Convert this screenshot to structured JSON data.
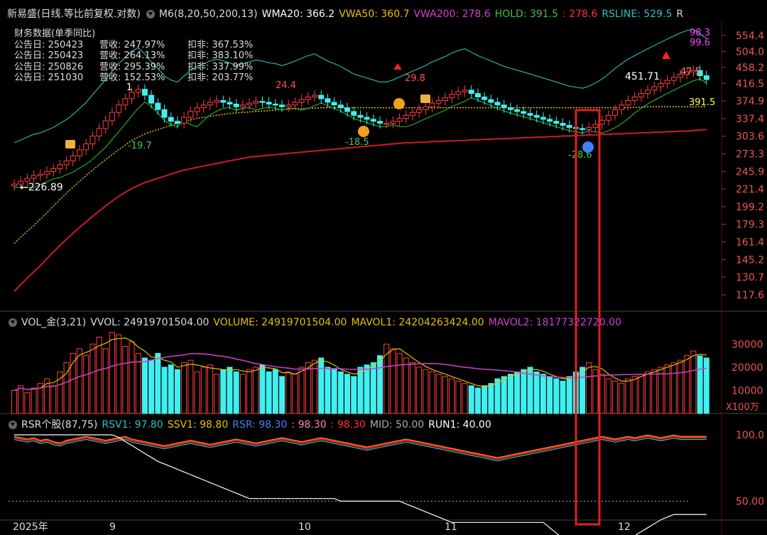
{
  "header": {
    "title": "新易盛(日线.等比前复权.对数)",
    "items": [
      {
        "text": "M6(8,20,50,200,13)",
        "color": "#dddddd"
      },
      {
        "text": "WMA20: 366.2",
        "color": "#ffffff"
      },
      {
        "text": "VWA50: 360.7",
        "color": "#e6c000"
      },
      {
        "text": "VWA200: 278.6",
        "color": "#d040d0"
      },
      {
        "text": "HOLD: 391.5",
        "color": "#40c040"
      },
      {
        "text": ": 278.6",
        "color": "#ff3030"
      },
      {
        "text": "RSLINE: 529.5",
        "color": "#30c0c0"
      },
      {
        "text": "R",
        "color": "#dddddd"
      }
    ]
  },
  "finance": {
    "title": "财务数据(单季同比)",
    "rows": [
      {
        "date": "公告日: 250423",
        "rev": "营收:  247.97%",
        "np": "扣非:  367.53%"
      },
      {
        "date": "公告日: 250423",
        "rev": "营收:  264.13%",
        "np": "扣非:  383.10%"
      },
      {
        "date": "公告日: 250826",
        "rev": "营收:  295.39%",
        "np": "扣非:  337.99%"
      },
      {
        "date": "公告日: 251030",
        "rev": "营收:  152.53%",
        "np": "扣非:  203.77%"
      }
    ]
  },
  "price_axis": [
    "554.4",
    "504.0",
    "458.2",
    "416.5",
    "374.9",
    "337.4",
    "303.6",
    "273.3",
    "245.9",
    "221.4",
    "199.2",
    "179.3",
    "161.4",
    "145.2",
    "130.7",
    "117.6"
  ],
  "annotations": {
    "low_label": "226.89",
    "high_right": "98.3",
    "high_right2": "99.6",
    "hold_label": "391.5",
    "peak": "451.71",
    "peak2": "47.5",
    "a1": "24.4",
    "a2": "29.8",
    "a3": "-19.7",
    "a4": "-18.5",
    "a5": "-28.6",
    "a6": "1"
  },
  "volume_panel": {
    "title": "VOL_金(3,21)",
    "items": [
      {
        "text": "VVOL: 24919701504.00",
        "color": "#dddddd"
      },
      {
        "text": "VOLUME: 24919701504.00",
        "color": "#e6c000"
      },
      {
        "text": "MAVOL1: 24204263424.00",
        "color": "#e6c000"
      },
      {
        "text": "MAVOL2: 18177322720.00",
        "color": "#d040d0"
      }
    ],
    "axis": [
      "30000",
      "20000",
      "10000"
    ],
    "unit": "X100万"
  },
  "rsr_panel": {
    "title": "RSR个股(87,75)",
    "items": [
      {
        "text": "RSV1: 97.80",
        "color": "#30c0c0"
      },
      {
        "text": "SSV1: 98.80",
        "color": "#e6c000"
      },
      {
        "text": "RSR: 98.30",
        "color": "#4080ff"
      },
      {
        "text": ": 98.30",
        "color": "#ff80c0"
      },
      {
        "text": ": 98.30",
        "color": "#ff3030"
      },
      {
        "text": "MID: 50.00",
        "color": "#aaaaaa"
      },
      {
        "text": "RUN1: 40.00",
        "color": "#ffffff"
      }
    ],
    "axis": [
      "100.0",
      "50.00"
    ]
  },
  "date_axis": [
    "2025年",
    "9",
    "10",
    "11",
    "12"
  ],
  "chart_data": {
    "type": "candlestick",
    "title": "新易盛(日线.等比前复权.对数)",
    "price_ticks": [
      554.4,
      504.0,
      458.2,
      416.5,
      374.9,
      337.4,
      303.6,
      273.3,
      245.9,
      221.4,
      199.2,
      179.3,
      161.4,
      145.2,
      130.7,
      117.6
    ],
    "closes": [
      228,
      232,
      236,
      240,
      242,
      246,
      250,
      256,
      262,
      270,
      280,
      290,
      304,
      318,
      333,
      350,
      366,
      380,
      395,
      402,
      388,
      370,
      356,
      340,
      332,
      328,
      340,
      352,
      360,
      366,
      372,
      376,
      372,
      368,
      362,
      366,
      370,
      374,
      372,
      368,
      366,
      362,
      366,
      372,
      378,
      384,
      388,
      380,
      372,
      366,
      360,
      352,
      344,
      340,
      336,
      332,
      328,
      328,
      332,
      338,
      344,
      350,
      356,
      362,
      370,
      376,
      382,
      390,
      396,
      400,
      392,
      384,
      378,
      372,
      366,
      360,
      356,
      352,
      348,
      344,
      340,
      336,
      332,
      328,
      324,
      320,
      318,
      316,
      320,
      326,
      334,
      344,
      356,
      366,
      376,
      384,
      392,
      400,
      408,
      416,
      424,
      432,
      440,
      446,
      450,
      436,
      426
    ],
    "vwa200": [
      120,
      125,
      130,
      135,
      140,
      146,
      152,
      158,
      164,
      170,
      176,
      182,
      188,
      194,
      200,
      206,
      212,
      217,
      222,
      226,
      230,
      233,
      236,
      239,
      242,
      245,
      248,
      250,
      252,
      254,
      256,
      258,
      260,
      262,
      264,
      266,
      268,
      269,
      270,
      271,
      272,
      273,
      274,
      275,
      276,
      277,
      278,
      279,
      280,
      281,
      282,
      283,
      284,
      285,
      286,
      287,
      288,
      289,
      290,
      291,
      292,
      292,
      293,
      293,
      294,
      294,
      295,
      295,
      296,
      296,
      297,
      297,
      298,
      298,
      299,
      299,
      300,
      300,
      301,
      301,
      302,
      302,
      303,
      303,
      304,
      304,
      305,
      305,
      306,
      306,
      307,
      307,
      308,
      308,
      309,
      309,
      310,
      310,
      311,
      311,
      312,
      312,
      313,
      313,
      314,
      315,
      316
    ],
    "vwa50": [
      160,
      166,
      172,
      178,
      185,
      192,
      200,
      208,
      216,
      224,
      232,
      240,
      248,
      256,
      264,
      272,
      280,
      288,
      296,
      302,
      308,
      312,
      316,
      320,
      324,
      328,
      332,
      335,
      338,
      340,
      342,
      344,
      346,
      348,
      349,
      350,
      351,
      352,
      353,
      354,
      355,
      356,
      357,
      358,
      358,
      359,
      359,
      360,
      360,
      360,
      360,
      360,
      360,
      360,
      360,
      360,
      360,
      360,
      360,
      360,
      360,
      360,
      360,
      360,
      360,
      360,
      360,
      360,
      360,
      360,
      360,
      360,
      360,
      360,
      360,
      360,
      360,
      360,
      360,
      360,
      360,
      360,
      360,
      360,
      360,
      360,
      360,
      360,
      360,
      360,
      360,
      360,
      360,
      360,
      360,
      361,
      361,
      362,
      362,
      362,
      362,
      362,
      362,
      362,
      362,
      362,
      362
    ],
    "volume_x100m": [
      100,
      120,
      90,
      110,
      130,
      150,
      120,
      180,
      220,
      260,
      280,
      250,
      300,
      330,
      280,
      350,
      340,
      290,
      310,
      260,
      240,
      230,
      260,
      200,
      210,
      190,
      220,
      230,
      180,
      200,
      210,
      170,
      190,
      200,
      180,
      170,
      190,
      200,
      210,
      180,
      190,
      160,
      180,
      170,
      200,
      220,
      230,
      240,
      200,
      190,
      180,
      170,
      160,
      200,
      210,
      220,
      250,
      300,
      280,
      260,
      240,
      220,
      200,
      190,
      180,
      170,
      160,
      150,
      140,
      130,
      120,
      110,
      120,
      130,
      150,
      160,
      170,
      180,
      190,
      200,
      180,
      170,
      160,
      150,
      140,
      160,
      180,
      200,
      220,
      190,
      170,
      150,
      140,
      130,
      150,
      160,
      170,
      180,
      190,
      200,
      210,
      220,
      230,
      250,
      270,
      249,
      240
    ],
    "rsr": [
      98,
      97,
      96,
      97,
      95,
      96,
      94,
      93,
      95,
      96,
      97,
      98,
      97,
      96,
      95,
      96,
      97,
      98,
      96,
      95,
      94,
      93,
      92,
      91,
      92,
      93,
      94,
      95,
      94,
      93,
      92,
      93,
      94,
      95,
      96,
      95,
      94,
      93,
      94,
      95,
      96,
      97,
      96,
      95,
      94,
      95,
      96,
      97,
      96,
      95,
      94,
      93,
      92,
      91,
      90,
      91,
      92,
      93,
      94,
      95,
      96,
      95,
      94,
      93,
      92,
      91,
      90,
      89,
      88,
      87,
      86,
      85,
      84,
      83,
      82,
      83,
      84,
      85,
      86,
      87,
      88,
      89,
      90,
      91,
      92,
      93,
      94,
      95,
      96,
      97,
      98,
      97,
      96,
      97,
      98,
      97,
      98,
      99,
      98,
      97,
      98,
      99,
      98,
      98,
      98,
      98,
      98
    ],
    "run1": [
      100,
      100,
      100,
      100,
      100,
      100,
      100,
      100,
      100,
      100,
      100,
      100,
      100,
      100,
      100,
      100,
      98,
      95,
      92,
      89,
      86,
      83,
      80,
      78,
      76,
      74,
      72,
      70,
      68,
      66,
      64,
      62,
      60,
      58,
      56,
      54,
      52,
      52,
      52,
      52,
      52,
      52,
      52,
      52,
      52,
      52,
      52,
      52,
      52,
      52,
      50,
      50,
      50,
      50,
      50,
      50,
      50,
      50,
      50,
      50,
      48,
      46,
      44,
      42,
      40,
      38,
      36,
      34,
      34,
      34,
      34,
      34,
      34,
      34,
      34,
      34,
      34,
      34,
      34,
      34,
      34,
      34,
      30,
      26,
      22,
      18,
      14,
      12,
      10,
      10,
      10,
      12,
      15,
      18,
      21,
      24,
      27,
      30,
      33,
      36,
      38,
      40,
      40,
      40,
      40,
      40,
      40
    ],
    "mid": 50.0,
    "rsr_ticks": [
      100.0,
      50.0
    ],
    "volume_ticks": [
      30000,
      20000,
      10000
    ],
    "x_labels": [
      "2025年",
      "9",
      "10",
      "11",
      "12"
    ]
  }
}
